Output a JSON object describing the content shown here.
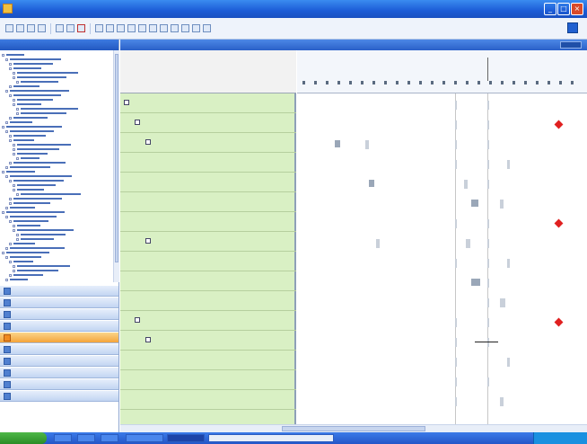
{
  "window": {
    "title": "",
    "buttons": {
      "minimize": "_",
      "maximize": "□",
      "close": "×"
    }
  },
  "gantt": {
    "column_header": "",
    "time_header": {
      "labels": [
        "",
        "",
        ""
      ]
    },
    "rows": [
      {
        "label": "",
        "level": 0,
        "expand": "−"
      },
      {
        "label": "",
        "level": 1,
        "expand": "−"
      },
      {
        "label": "",
        "level": 2,
        "expand": "−"
      },
      {
        "label": "",
        "level": 3
      },
      {
        "label": "",
        "level": 3
      },
      {
        "label": "",
        "level": 3
      },
      {
        "label": "",
        "level": 2
      },
      {
        "label": "",
        "level": 2,
        "expand": "−"
      },
      {
        "label": "",
        "level": 3
      },
      {
        "label": "",
        "level": 3
      },
      {
        "label": "",
        "level": 3
      },
      {
        "label": "",
        "level": 1,
        "expand": "−"
      },
      {
        "label": "",
        "level": 2,
        "expand": "−"
      },
      {
        "label": "",
        "level": 3
      },
      {
        "label": "",
        "level": 3
      },
      {
        "label": "",
        "level": 3
      },
      {
        "label": "",
        "level": 1
      }
    ]
  },
  "navbar": {
    "items": [
      {
        "label": "",
        "active": false
      },
      {
        "label": "",
        "active": false
      },
      {
        "label": "",
        "active": false
      },
      {
        "label": "",
        "active": false
      },
      {
        "label": "",
        "active": true
      },
      {
        "label": "",
        "active": false
      },
      {
        "label": "",
        "active": false
      },
      {
        "label": "",
        "active": false
      },
      {
        "label": "",
        "active": false
      },
      {
        "label": "",
        "active": false
      }
    ]
  },
  "colors": {
    "titlebar": "#1c5cd6",
    "grid_background": "#d9f0c4",
    "milestone": "#e02020",
    "active_nav": "#f4a43a",
    "taskbar": "#2456c8",
    "start_button": "#2a8c26"
  }
}
